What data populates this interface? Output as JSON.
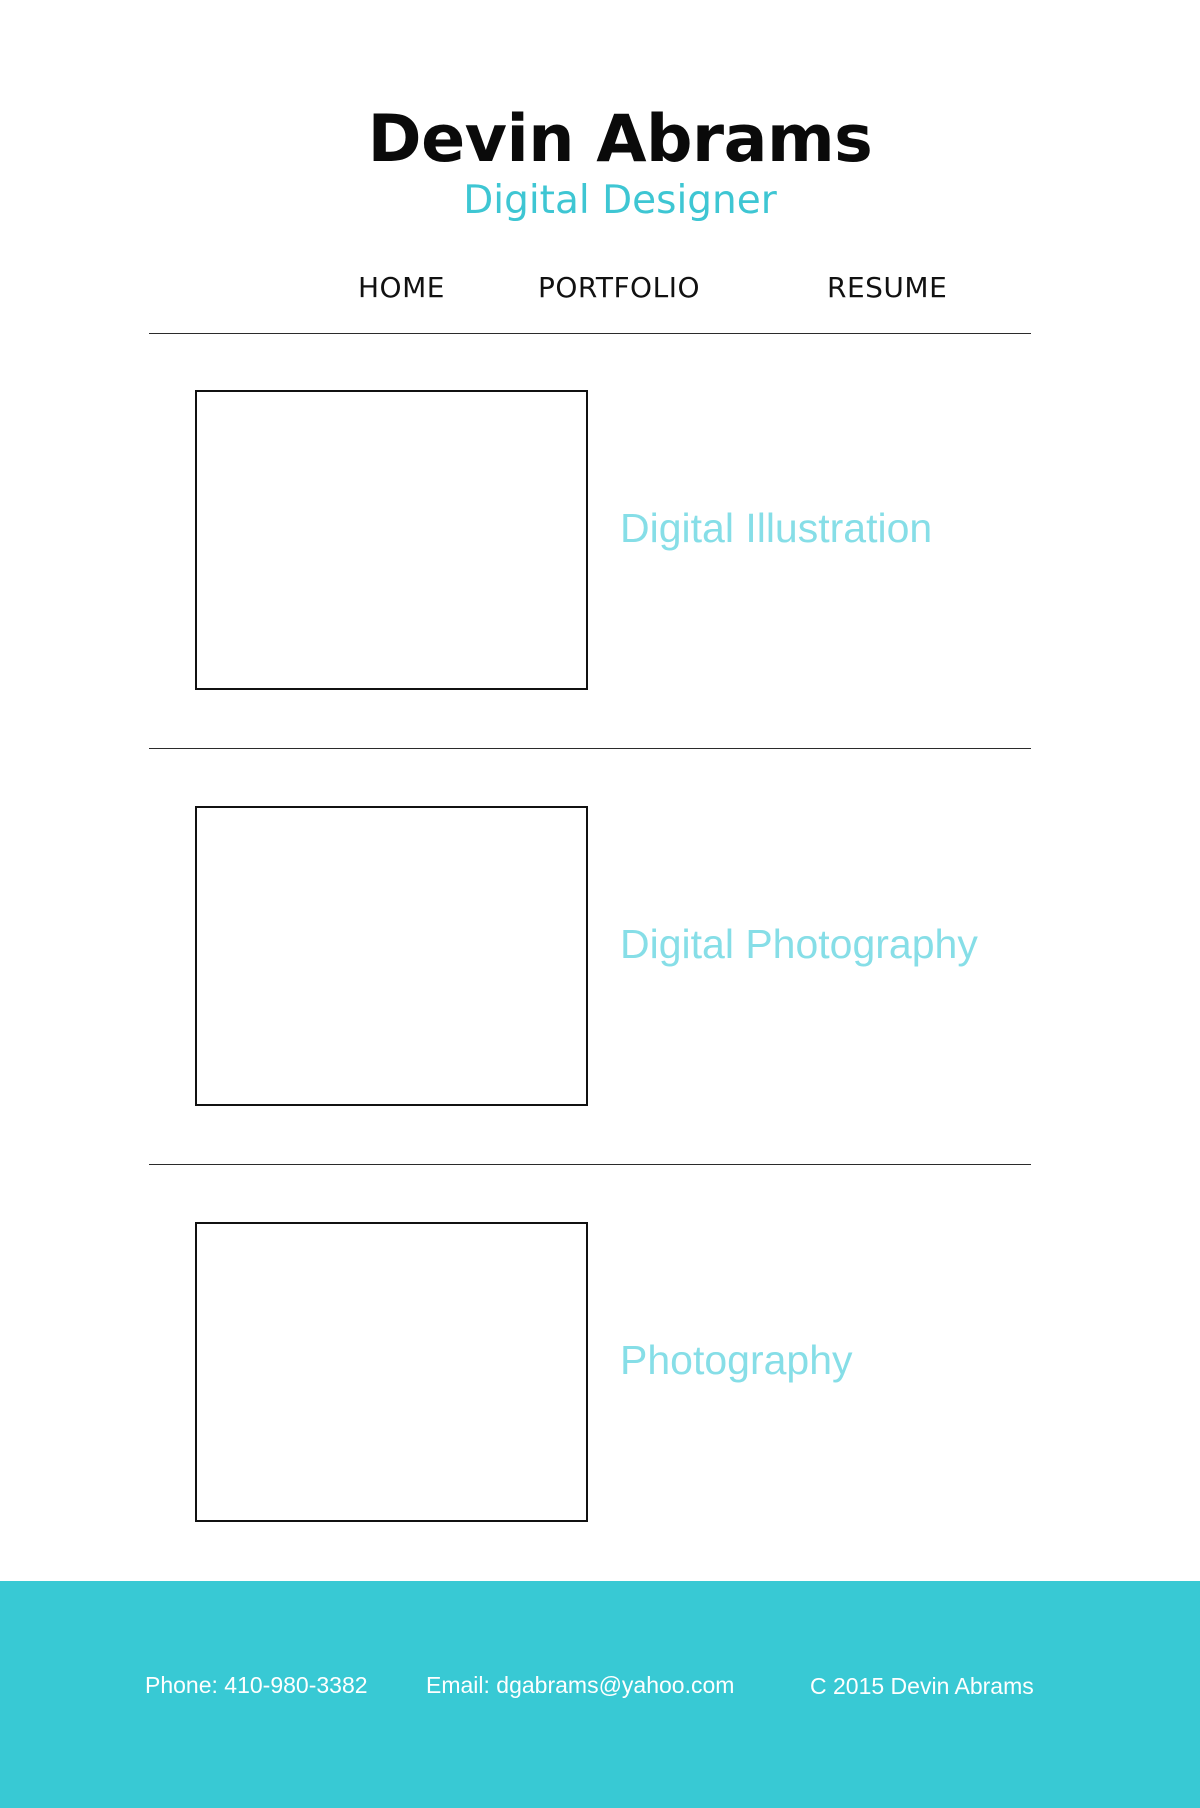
{
  "header": {
    "name": "Devin Abrams",
    "tagline": "Digital Designer"
  },
  "nav": {
    "items": [
      {
        "label": "HOME"
      },
      {
        "label": "PORTFOLIO"
      },
      {
        "label": "RESUME"
      }
    ]
  },
  "portfolio": {
    "items": [
      {
        "title": "Digital Illustration"
      },
      {
        "title": "Digital Photography"
      },
      {
        "title": "Photography"
      }
    ]
  },
  "footer": {
    "phone": "Phone: 410-980-3382",
    "email": "Email: dgabrams@yahoo.com",
    "copyright": "C 2015 Devin Abrams"
  },
  "colors": {
    "accent": "#38c9d4",
    "subtitle": "#3ec6d3",
    "card_title": "#86dee7",
    "text": "#111111",
    "background": "#ffffff"
  }
}
